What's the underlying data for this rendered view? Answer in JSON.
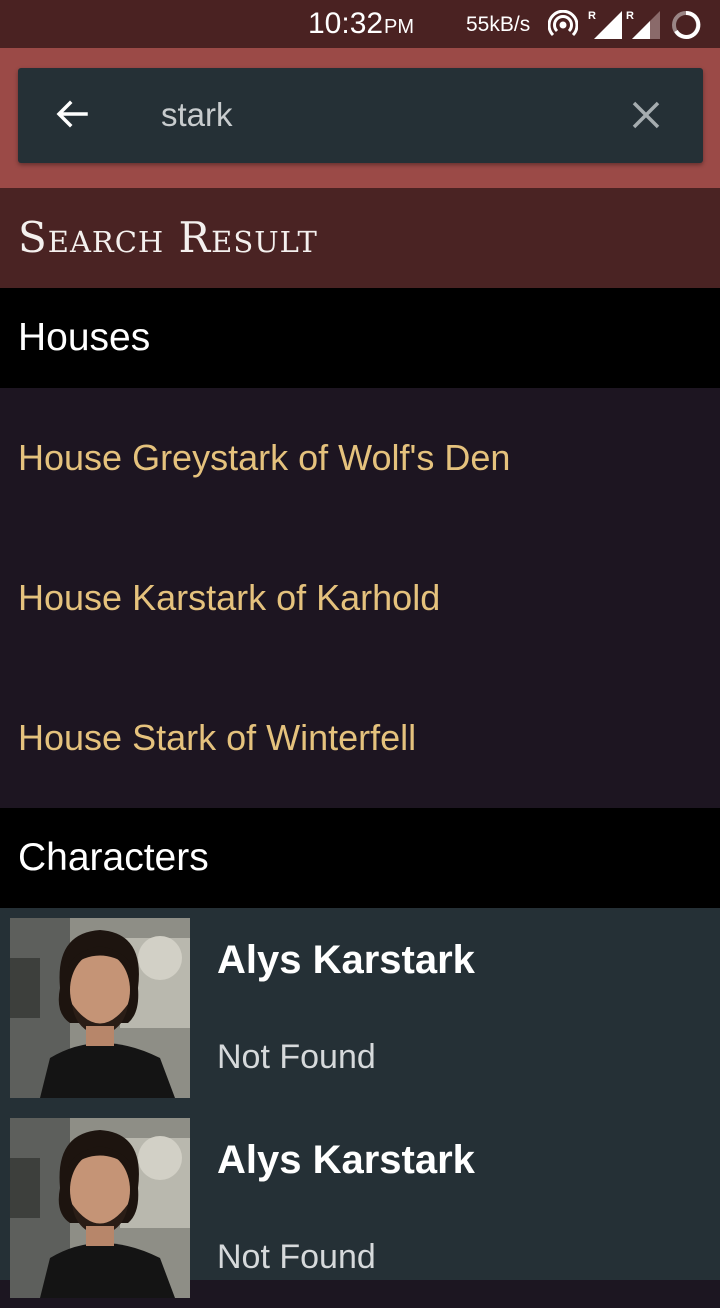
{
  "status_bar": {
    "time": "10:32",
    "ampm": "PM",
    "speed": "55kB/s",
    "icons": [
      "hotspot-icon",
      "signal-roaming-icon",
      "signal-roaming-icon",
      "battery-charging-icon"
    ]
  },
  "search": {
    "value": "stark",
    "back_icon": "arrow-left-icon",
    "clear_icon": "close-icon"
  },
  "result_header": {
    "title": "Search Result"
  },
  "houses": {
    "title": "Houses",
    "items": [
      {
        "label": "House Greystark of Wolf's Den"
      },
      {
        "label": "House Karstark of Karhold"
      },
      {
        "label": "House Stark of Winterfell"
      }
    ]
  },
  "characters": {
    "title": "Characters",
    "items": [
      {
        "name": "Alys Karstark",
        "status": "Not Found",
        "avatar": "character-photo"
      },
      {
        "name": "Alys Karstark",
        "status": "Not Found",
        "avatar": "character-photo"
      }
    ]
  },
  "colors": {
    "status_bar": "#4a2222",
    "search_bg": "#9b4a47",
    "header_bg": "#4a2323",
    "house_text": "#e5c27d",
    "list_bg": "#1d1521",
    "card_bg": "#253036"
  }
}
